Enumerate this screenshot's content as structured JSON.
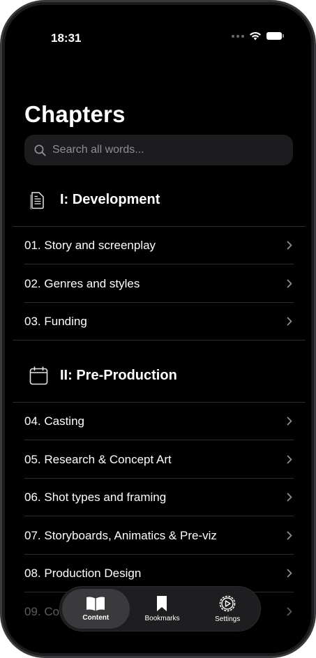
{
  "status_bar": {
    "time": "18:31"
  },
  "header": {
    "title": "Chapters"
  },
  "search": {
    "placeholder": "Search all words..."
  },
  "sections": [
    {
      "title": "I: Development",
      "icon": "document-icon",
      "items": [
        {
          "label": "01. Story and screenplay"
        },
        {
          "label": "02. Genres and styles"
        },
        {
          "label": "03. Funding"
        }
      ]
    },
    {
      "title": "II: Pre-Production",
      "icon": "calendar-icon",
      "items": [
        {
          "label": "04. Casting"
        },
        {
          "label": "05. Research & Concept Art"
        },
        {
          "label": "06. Shot types and framing"
        },
        {
          "label": "07. Storyboards, Animatics & Pre-viz"
        },
        {
          "label": "08. Production Design"
        },
        {
          "label": "09. Co"
        }
      ]
    }
  ],
  "tab_bar": {
    "tabs": [
      {
        "label": "Content",
        "icon": "book-icon",
        "active": true
      },
      {
        "label": "Bookmarks",
        "icon": "bookmark-icon",
        "active": false
      },
      {
        "label": "Settings",
        "icon": "gear-icon",
        "active": false
      }
    ]
  }
}
